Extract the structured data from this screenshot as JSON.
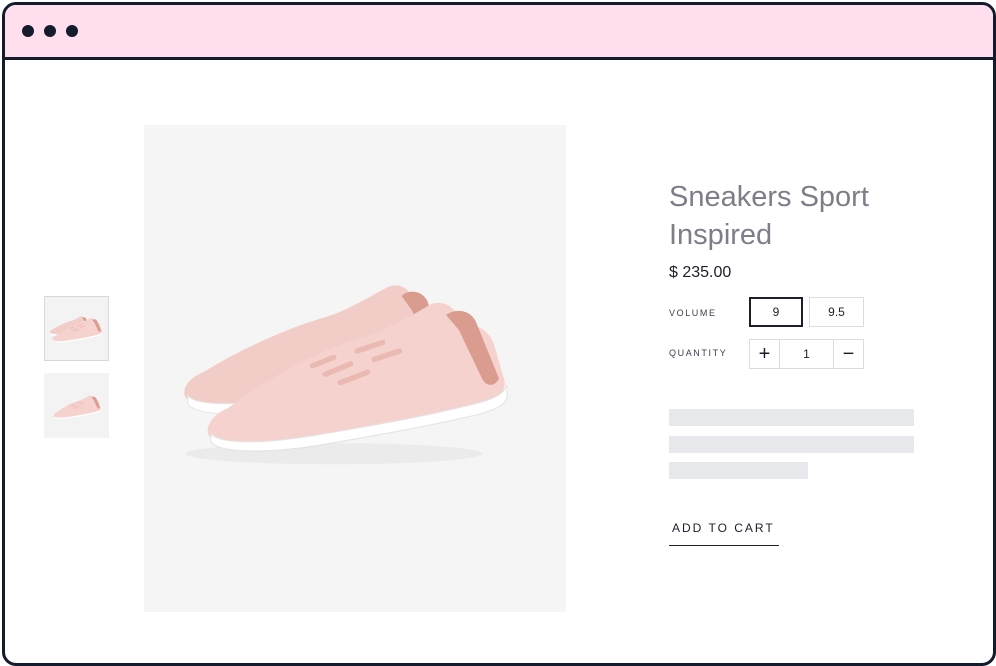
{
  "window": {
    "titlebar_color": "#ffdfee",
    "controls": [
      "dot",
      "dot",
      "dot"
    ]
  },
  "gallery": {
    "thumbnails": [
      {
        "name": "thumbnail-pair-view",
        "selected": true
      },
      {
        "name": "thumbnail-side-view",
        "selected": false
      }
    ],
    "main_image": "pink-sneakers-photo"
  },
  "product": {
    "title": "Sneakers Sport Inspired",
    "price": "$ 235.00",
    "volume": {
      "label": "VOLUME",
      "options": [
        "9",
        "9.5"
      ],
      "selected": "9"
    },
    "quantity": {
      "label": "QUANTITY",
      "value": "1",
      "increment": "+",
      "decrement": "−"
    },
    "add_to_cart": "ADD TO CART"
  },
  "colors": {
    "accent_dark": "#141b2d",
    "title_gray": "#7e7e8a",
    "placeholder_gray": "#e7e8ec",
    "shoe_pink": "#f6d2ce"
  }
}
